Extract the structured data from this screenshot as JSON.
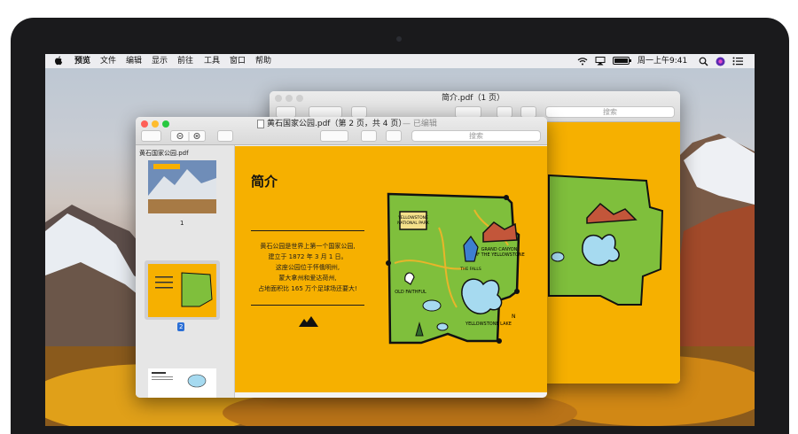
{
  "menubar": {
    "app": "预览",
    "items": [
      "文件",
      "编辑",
      "显示",
      "前往",
      "工具",
      "窗口",
      "帮助"
    ],
    "clock": "周一上午9:41"
  },
  "back_window": {
    "title": "简介.pdf（1 页）",
    "search_placeholder": "搜索"
  },
  "front_window": {
    "title": "黄石国家公园.pdf（第 2 页，共 4 页）",
    "edited": "— 已编辑",
    "search_placeholder": "搜索",
    "sidebar": {
      "document_name": "黄石国家公园.pdf",
      "pages": [
        {
          "number": "1",
          "selected": false
        },
        {
          "number": "2",
          "selected": true
        },
        {
          "number": "",
          "selected": false
        }
      ]
    },
    "page": {
      "heading": "简介",
      "lines": [
        "黄石公园是世界上第一个国家公园,",
        "建立于 1872 年 3 月 1 日。",
        "这座公园位于怀俄明州,",
        "蒙大拿州和爱达荷州,",
        "占地面积比 165 万个足球场还要大!"
      ]
    },
    "map_labels": {
      "park": "YELLOWSTONE NATIONAL PARK",
      "canyon": "GRAND CANYON OF THE YELLOWSTONE",
      "falls": "THE FALLS",
      "old_faithful": "OLD FAITHFUL",
      "lake": "YELLOWSTONE LAKE",
      "north": "N"
    }
  },
  "colors": {
    "page_orange": "#f6b000",
    "map_green": "#7fbf3c",
    "selection_blue": "#2b6fd6"
  }
}
